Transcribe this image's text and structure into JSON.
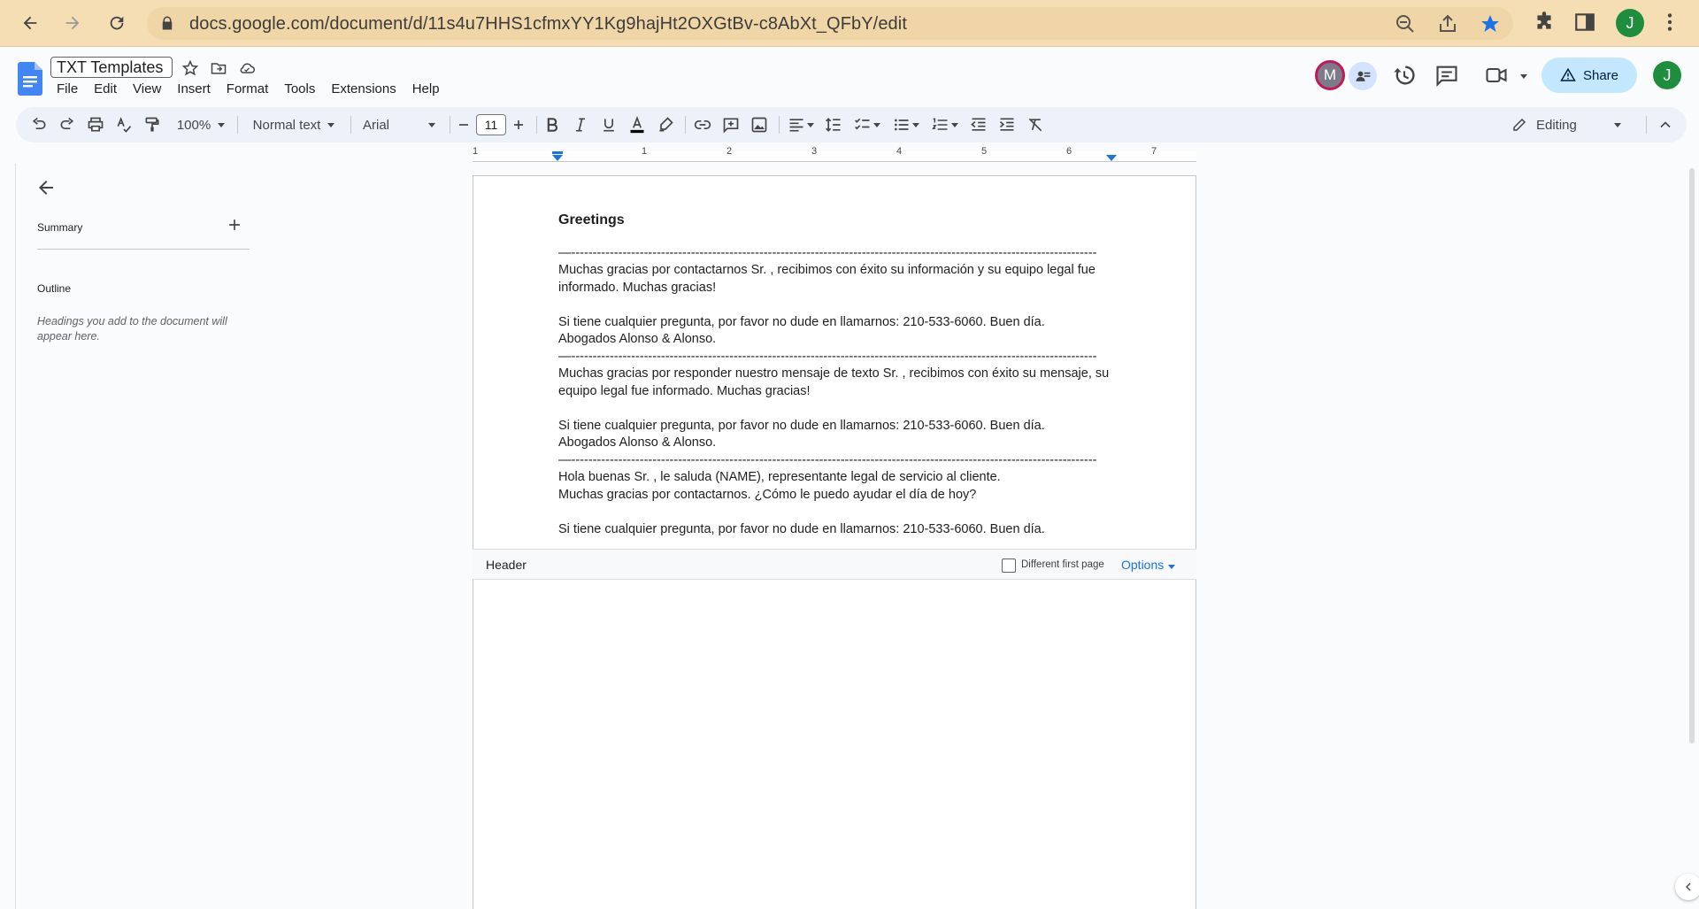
{
  "browser": {
    "url": "docs.google.com/document/d/11s4u7HHS1cfmxYY1Kg9hajHt2OXGtBv-c8AbXt_QFbY/edit",
    "profile_initial": "J"
  },
  "docs": {
    "title": "TXT Templates",
    "menu": [
      "File",
      "Edit",
      "View",
      "Insert",
      "Format",
      "Tools",
      "Extensions",
      "Help"
    ],
    "share_label": "Share",
    "collaborator_initial": "M",
    "user_initial": "J"
  },
  "toolbar": {
    "zoom": "100%",
    "style": "Normal text",
    "font": "Arial",
    "font_size": "11",
    "mode": "Editing"
  },
  "ruler": {
    "numbers": [
      "1",
      "1",
      "2",
      "3",
      "4",
      "5",
      "6",
      "7"
    ]
  },
  "sidebar": {
    "summary_label": "Summary",
    "outline_label": "Outline",
    "outline_hint": "Headings you add to the document will appear here."
  },
  "document": {
    "heading": "Greetings",
    "dashes": "—---------------------------------------------------------------------------------------------------------------------------",
    "p1": "Muchas gracias por contactarnos Sr. , recibimos con éxito su información y su equipo legal fue informado. Muchas gracias!",
    "p2": "Si tiene cualquier pregunta, por favor no dude en llamarnos: 210-533-6060. Buen día.",
    "p3": "Abogados Alonso & Alonso.",
    "p4": "Muchas gracias por responder nuestro mensaje de texto Sr. , recibimos con éxito su mensaje, su equipo legal fue informado. Muchas gracias!",
    "p5": "Si tiene cualquier pregunta, por favor no dude en llamarnos: 210-533-6060. Buen día.",
    "p6": "Abogados Alonso & Alonso.",
    "p7": "Hola buenas Sr. , le saluda (NAME), representante legal de servicio al cliente.",
    "p8": "Muchas gracias por contactarnos. ¿Cómo le puedo ayudar el día de hoy?",
    "p9": "Si tiene cualquier pregunta, por favor no dude en llamarnos: 210-533-6060. Buen día."
  },
  "header_bar": {
    "label": "Header",
    "different_first_page": "Different first page",
    "options": "Options"
  },
  "colors": {
    "chrome": "#f5deb3",
    "share": "#c2e7ff",
    "accent": "#1a73e8",
    "docs_blue": "#4285f4"
  }
}
